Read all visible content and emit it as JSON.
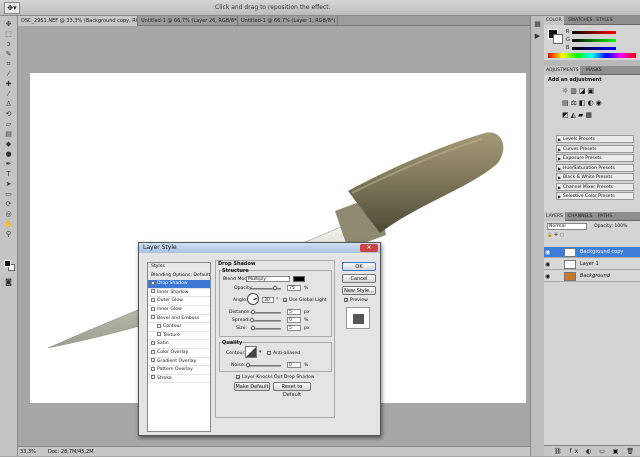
{
  "optbar": {
    "hint": "Click and drag to reposition the effect."
  },
  "doctabs": [
    {
      "label": "DSC_2951.NEF @ 33,3% (Background copy, RGB/8*)",
      "active": true
    },
    {
      "label": "Untitled-1 @ 66,7% (Layer 26, RGB/8*)",
      "active": false
    },
    {
      "label": "Untitled-1 @ 66,7% (Layer 1, RGB/8*)",
      "active": false
    }
  ],
  "status": {
    "zoom": "33,3%",
    "doc": "Doc: 28,7M/45,2M"
  },
  "panels": {
    "color_tabs": [
      "COLOR",
      "SWATCHES",
      "STYLES"
    ],
    "rgb_labels": [
      "R",
      "G",
      "B"
    ],
    "adj_tabs": [
      "ADJUSTMENTS",
      "MASKS"
    ],
    "adj_title": "Add an adjustment",
    "presets": [
      "Levels Presets",
      "Curves Presets",
      "Exposure Presets",
      "Hue/Saturation Presets",
      "Black & White Presets",
      "Channel Mixer Presets",
      "Selective Color Presets"
    ],
    "layer_tabs": [
      "LAYERS",
      "CHANNELS",
      "PATHS"
    ],
    "blend": "Normal",
    "opacity_label": "Opacity: 100%",
    "layers": [
      {
        "name": "Background copy",
        "selected": true
      },
      {
        "name": "Layer 1",
        "selected": false
      },
      {
        "name": "Background",
        "selected": false
      }
    ]
  },
  "dialog": {
    "title": "Layer Style",
    "styles": [
      {
        "label": "Styles",
        "type": "hdr"
      },
      {
        "label": "Blending Options: Default",
        "type": "hdr"
      },
      {
        "label": "Drop Shadow",
        "type": "sel"
      },
      {
        "label": "Inner Shadow",
        "type": "cb"
      },
      {
        "label": "Outer Glow",
        "type": "cb"
      },
      {
        "label": "Inner Glow",
        "type": "cb"
      },
      {
        "label": "Bevel and Emboss",
        "type": "cb"
      },
      {
        "label": "Contour",
        "type": "indent"
      },
      {
        "label": "Texture",
        "type": "indent"
      },
      {
        "label": "Satin",
        "type": "cb"
      },
      {
        "label": "Color Overlay",
        "type": "cb"
      },
      {
        "label": "Gradient Overlay",
        "type": "cb"
      },
      {
        "label": "Pattern Overlay",
        "type": "cb"
      },
      {
        "label": "Stroke",
        "type": "cb"
      }
    ],
    "section_title": "Drop Shadow",
    "structure_label": "Structure",
    "blend_mode_label": "Blend Mode:",
    "blend_mode_value": "Multiply",
    "opacity_label": "Opacity:",
    "opacity_value": "75",
    "angle_label": "Angle:",
    "angle_value": "30",
    "use_global_light": "Use Global Light",
    "distance_label": "Distance:",
    "distance_value": "5",
    "spread_label": "Spread:",
    "spread_value": "0",
    "size_label": "Size:",
    "size_value": "5",
    "unit_px": "px",
    "unit_pct": "%",
    "quality_label": "Quality",
    "contour_label": "Contour:",
    "anti_aliased": "Anti-aliased",
    "noise_label": "Noise:",
    "noise_value": "0",
    "knocks_out": "Layer Knocks Out Drop Shadow",
    "make_default": "Make Default",
    "reset_default": "Reset to Default",
    "ok": "OK",
    "cancel": "Cancel",
    "new_style": "New Style...",
    "preview": "Preview"
  }
}
